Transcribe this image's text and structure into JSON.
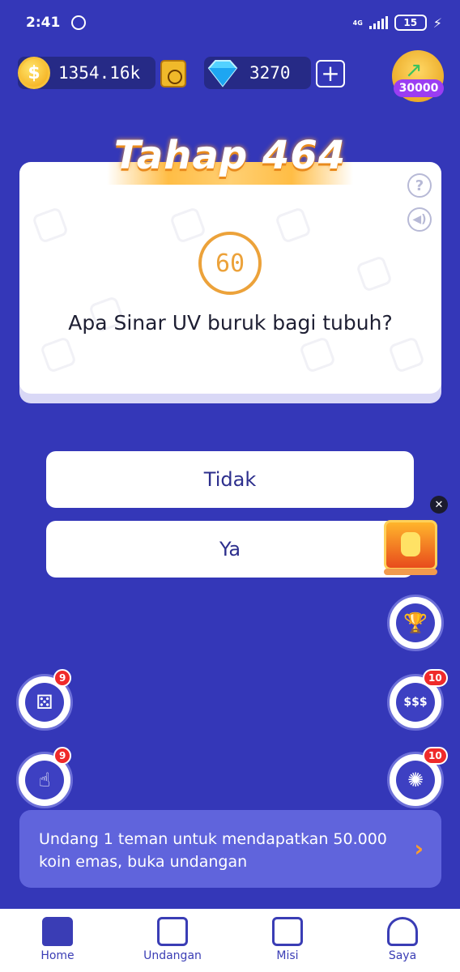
{
  "status_bar": {
    "time": "2:41",
    "network": "4G",
    "battery": "15"
  },
  "header": {
    "coin_balance": "1354.16k",
    "gem_balance": "3270",
    "add_label": "+",
    "reward_amount": "30000"
  },
  "quiz": {
    "stage_title": "Tahap 464",
    "timer": "60",
    "question": "Apa Sinar UV buruk bagi tubuh?",
    "answers": [
      "Tidak",
      "Ya"
    ]
  },
  "badges": {
    "dice": "9",
    "slot": "10",
    "scratch": "9",
    "wheel": "10"
  },
  "invite_banner": {
    "text": "Undang 1 teman untuk mendapatkan 50.000 koin emas, buka undangan"
  },
  "bottom_nav": {
    "items": [
      {
        "label": "Home",
        "icon": "home-icon"
      },
      {
        "label": "Undangan",
        "icon": "invite-icon"
      },
      {
        "label": "Misi",
        "icon": "mission-list-icon"
      },
      {
        "label": "Saya",
        "icon": "profile-icon"
      }
    ]
  },
  "colors": {
    "background": "#3437b8",
    "accent": "#3a3db5",
    "timer": "#eca23a",
    "badge": "#ef2a2a"
  }
}
